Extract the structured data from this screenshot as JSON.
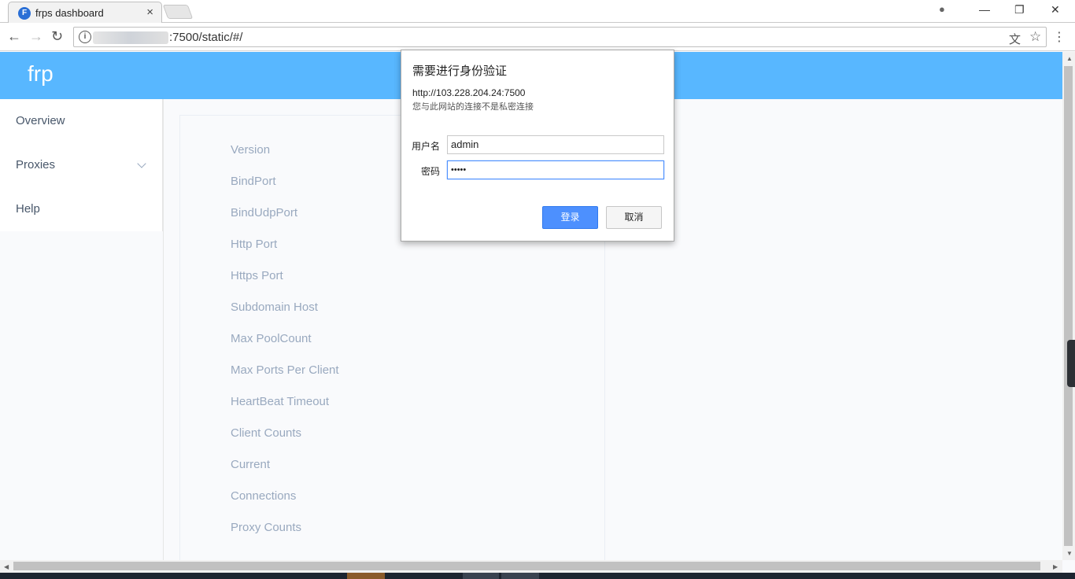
{
  "browser": {
    "tab": {
      "title": "frps dashboard",
      "favicon_letter": "F",
      "close_glyph": "×"
    },
    "window_controls": {
      "account": "●",
      "minimize": "—",
      "restore": "❐",
      "close": "✕"
    },
    "nav": {
      "back": "←",
      "forward": "→",
      "reload": "↻"
    },
    "address": {
      "url_suffix": ":7500/static/#/",
      "info_glyph": "i",
      "translate_glyph": "文",
      "star_glyph": "☆",
      "menu_glyph": "⋮"
    }
  },
  "app": {
    "logo": "frp",
    "sidebar": {
      "items": [
        {
          "label": "Overview"
        },
        {
          "label": "Proxies"
        },
        {
          "label": "Help"
        }
      ]
    },
    "overview_fields": [
      "Version",
      "BindPort",
      "BindUdpPort",
      "Http Port",
      "Https Port",
      "Subdomain Host",
      "Max PoolCount",
      "Max Ports Per Client",
      "HeartBeat Timeout",
      "Client Counts",
      "Current",
      "Connections",
      "Proxy Counts"
    ]
  },
  "auth_dialog": {
    "title": "需要进行身份验证",
    "url": "http://103.228.204.24:7500",
    "warning": "您与此网站的连接不是私密连接",
    "username_label": "用户名",
    "username_value": "admin",
    "password_label": "密码",
    "password_value": "•••••",
    "login_button": "登录",
    "cancel_button": "取消"
  },
  "colors": {
    "header": "#58b7ff",
    "primary_button": "#4d90fe",
    "label_text": "#99a9bf"
  }
}
